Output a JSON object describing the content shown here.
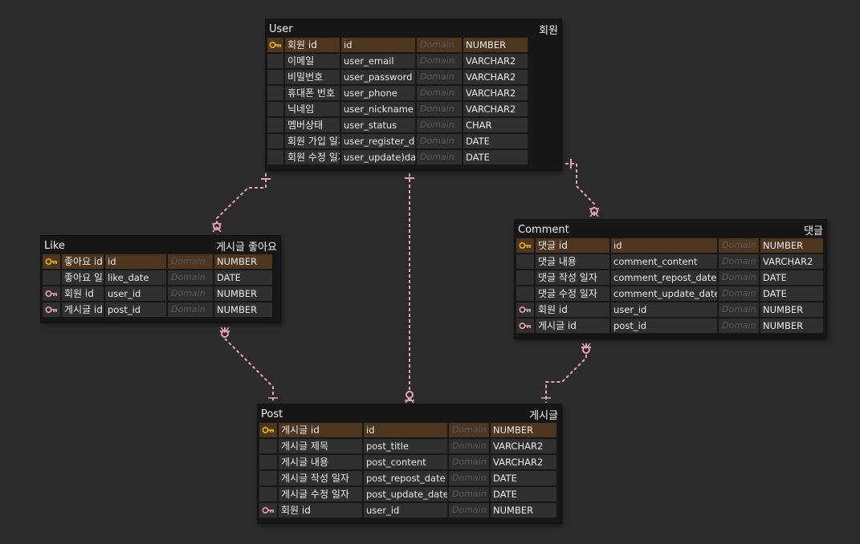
{
  "colors": {
    "pk_key": "#e6b800",
    "fk_key": "#e8a0b0",
    "link": "#e7a3b7"
  },
  "entities": [
    {
      "id": "user",
      "name": "User",
      "label": "회원",
      "columns": [
        {
          "key": "pk",
          "logical": "회원 id",
          "physical": "id",
          "domain": "Domain",
          "type": "NUMBER"
        },
        {
          "key": "",
          "logical": "이메일",
          "physical": "user_email",
          "domain": "Domain",
          "type": "VARCHAR2"
        },
        {
          "key": "",
          "logical": "비밀번호",
          "physical": "user_password",
          "domain": "Domain",
          "type": "VARCHAR2"
        },
        {
          "key": "",
          "logical": "휴대폰 번호",
          "physical": "user_phone",
          "domain": "Domain",
          "type": "VARCHAR2"
        },
        {
          "key": "",
          "logical": "닉네임",
          "physical": "user_nickname",
          "domain": "Domain",
          "type": "VARCHAR2"
        },
        {
          "key": "",
          "logical": "멤버상태",
          "physical": "user_status",
          "domain": "Domain",
          "type": "CHAR"
        },
        {
          "key": "",
          "logical": "회원 가입 일자",
          "physical": "user_register_date",
          "domain": "Domain",
          "type": "DATE"
        },
        {
          "key": "",
          "logical": "회원 수정 일자",
          "physical": "user_update)date",
          "domain": "Domain",
          "type": "DATE"
        }
      ]
    },
    {
      "id": "like",
      "name": "Like",
      "label": "게시글 좋아요",
      "columns": [
        {
          "key": "pk",
          "logical": "좋아요 id",
          "physical": "id",
          "domain": "Domain",
          "type": "NUMBER"
        },
        {
          "key": "",
          "logical": "좋아요 일자",
          "physical": "like_date",
          "domain": "Domain",
          "type": "DATE"
        },
        {
          "key": "fk",
          "logical": "회원 id",
          "physical": "user_id",
          "domain": "Domain",
          "type": "NUMBER"
        },
        {
          "key": "fk",
          "logical": "게시글 id",
          "physical": "post_id",
          "domain": "Domain",
          "type": "NUMBER"
        }
      ]
    },
    {
      "id": "comment",
      "name": "Comment",
      "label": "댓글",
      "columns": [
        {
          "key": "pk",
          "logical": "댓글 id",
          "physical": "id",
          "domain": "Domain",
          "type": "NUMBER"
        },
        {
          "key": "",
          "logical": "댓글 내용",
          "physical": "comment_content",
          "domain": "Domain",
          "type": "VARCHAR2"
        },
        {
          "key": "",
          "logical": "댓글 작성 일자",
          "physical": "comment_repost_date",
          "domain": "Domain",
          "type": "DATE"
        },
        {
          "key": "",
          "logical": "댓글 수정 일자",
          "physical": "comment_update_date",
          "domain": "Domain",
          "type": "DATE"
        },
        {
          "key": "fk",
          "logical": "회원 id",
          "physical": "user_id",
          "domain": "Domain",
          "type": "NUMBER"
        },
        {
          "key": "fk",
          "logical": "게시글 id",
          "physical": "post_id",
          "domain": "Domain",
          "type": "NUMBER"
        }
      ]
    },
    {
      "id": "post",
      "name": "Post",
      "label": "게시글",
      "columns": [
        {
          "key": "pk",
          "logical": "게시글 id",
          "physical": "id",
          "domain": "Domain",
          "type": "NUMBER"
        },
        {
          "key": "",
          "logical": "게시글 제목",
          "physical": "post_title",
          "domain": "Domain",
          "type": "VARCHAR2"
        },
        {
          "key": "",
          "logical": "게시글 내용",
          "physical": "post_content",
          "domain": "Domain",
          "type": "VARCHAR2"
        },
        {
          "key": "",
          "logical": "게시글 작성 일자",
          "physical": "post_repost_date",
          "domain": "Domain",
          "type": "DATE"
        },
        {
          "key": "",
          "logical": "게시글 수정 일자",
          "physical": "post_update_date",
          "domain": "Domain",
          "type": "DATE"
        },
        {
          "key": "fk",
          "logical": "회원 id",
          "physical": "user_id",
          "domain": "Domain",
          "type": "NUMBER"
        }
      ]
    }
  ],
  "relationships": [
    {
      "from": "user",
      "to": "like"
    },
    {
      "from": "user",
      "to": "post"
    },
    {
      "from": "user",
      "to": "comment"
    },
    {
      "from": "post",
      "to": "like"
    },
    {
      "from": "post",
      "to": "comment"
    }
  ]
}
